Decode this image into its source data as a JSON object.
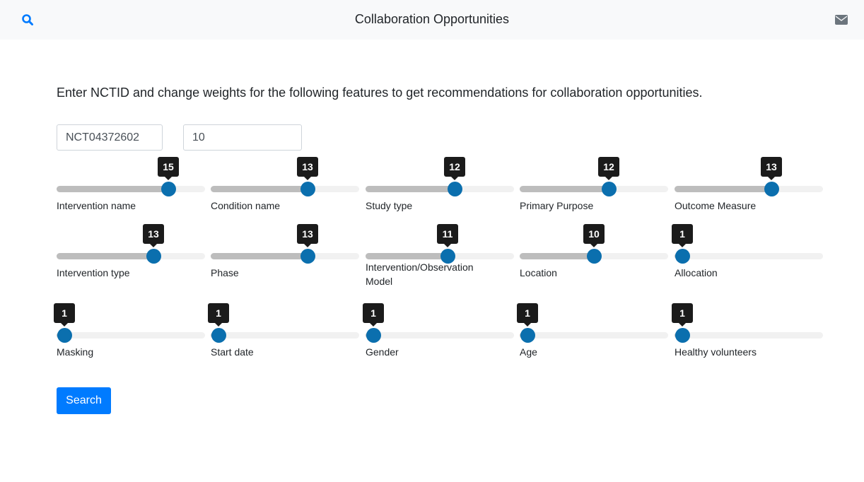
{
  "navbar": {
    "title": "Collaboration Opportunities",
    "search_icon": "search-icon",
    "mail_icon": "envelope-icon",
    "accent_color": "#007bff"
  },
  "intro": "Enter NCTID and change weights for the following features to get recommendations for collaboration opportunities.",
  "inputs": {
    "nctid": "NCT04372602",
    "count": "10"
  },
  "sliders": [
    {
      "label": "Intervention name",
      "value": 15,
      "fraction": 0.75
    },
    {
      "label": "Condition name",
      "value": 13,
      "fraction": 0.65
    },
    {
      "label": "Study type",
      "value": 12,
      "fraction": 0.6
    },
    {
      "label": "Primary Purpose",
      "value": 12,
      "fraction": 0.6
    },
    {
      "label": "Outcome Measure",
      "value": 13,
      "fraction": 0.65
    },
    {
      "label": "Intervention type",
      "value": 13,
      "fraction": 0.65
    },
    {
      "label": "Phase",
      "value": 13,
      "fraction": 0.65
    },
    {
      "label": "Intervention/Observation Model",
      "value": 11,
      "fraction": 0.55
    },
    {
      "label": "Location",
      "value": 10,
      "fraction": 0.5
    },
    {
      "label": "Allocation",
      "value": 1,
      "fraction": 0.05
    },
    {
      "label": "Masking",
      "value": 1,
      "fraction": 0.05
    },
    {
      "label": "Start date",
      "value": 1,
      "fraction": 0.05
    },
    {
      "label": "Gender",
      "value": 1,
      "fraction": 0.05
    },
    {
      "label": "Age",
      "value": 1,
      "fraction": 0.05
    },
    {
      "label": "Healthy volunteers",
      "value": 1,
      "fraction": 0.05
    }
  ],
  "search_button": "Search",
  "colors": {
    "thumb": "#0b6fae",
    "track_fill": "#bdbdbd",
    "bubble": "#1b1b1b",
    "button": "#007bff"
  }
}
